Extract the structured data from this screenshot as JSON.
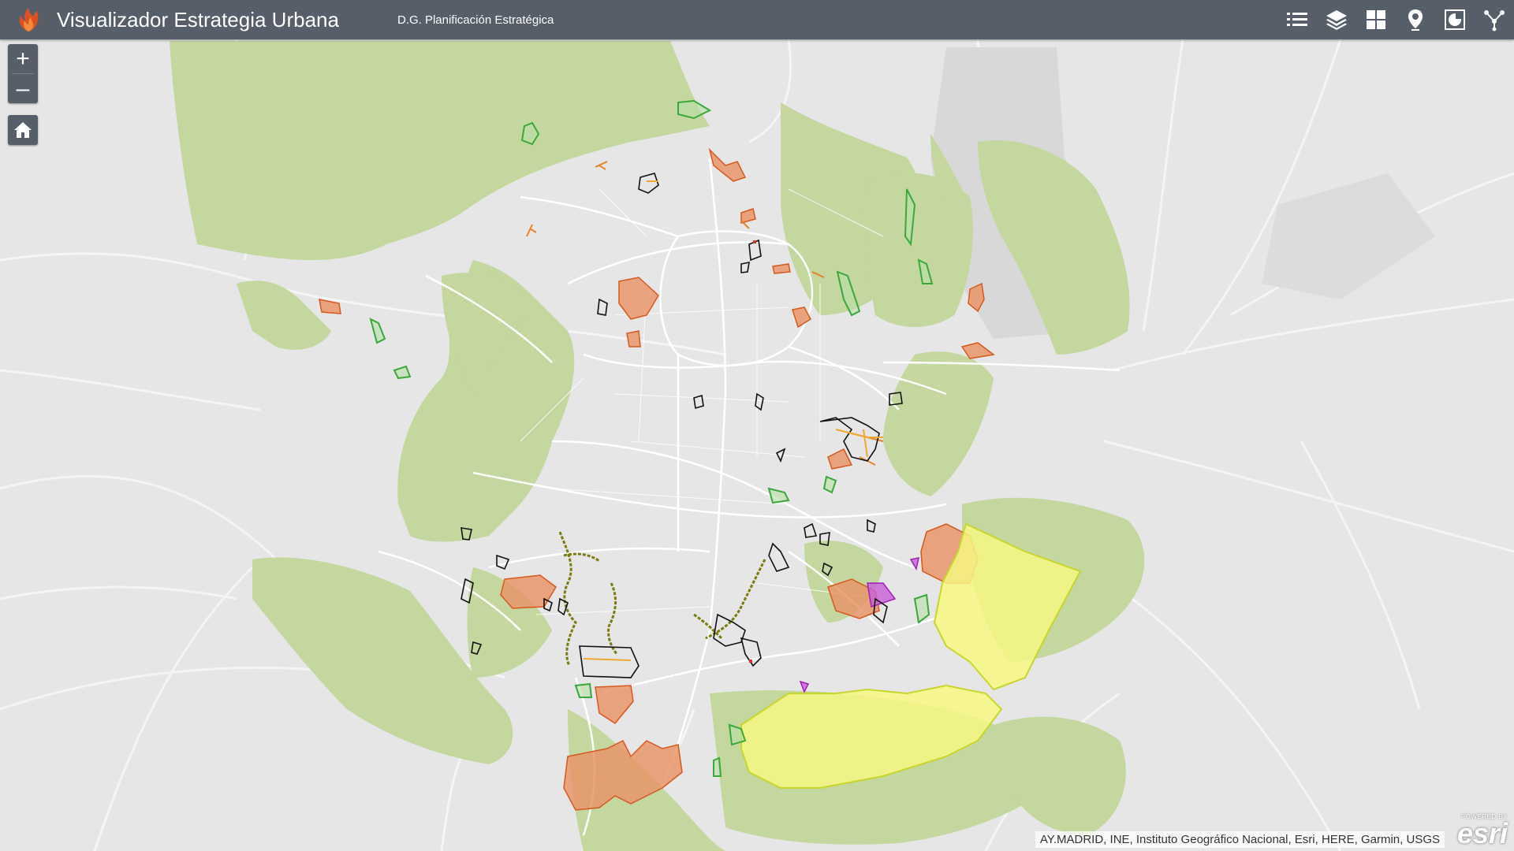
{
  "header": {
    "title": "Visualizador Estrategia Urbana",
    "subtitle": "D.G. Planificación Estratégica",
    "logo_icon": "flame-logo-icon",
    "tools": [
      {
        "name": "legend-list-icon"
      },
      {
        "name": "layers-icon"
      },
      {
        "name": "basemap-gallery-icon"
      },
      {
        "name": "location-pin-icon"
      },
      {
        "name": "chart-dashboard-icon"
      },
      {
        "name": "share-icon"
      }
    ]
  },
  "map": {
    "zoom_in_label": "+",
    "zoom_out_label": "–",
    "home_icon": "home-icon",
    "attribution": "AY.MADRID, INE, Instituto Geográfico Nacional, Esri, HERE, Garmin, USGS",
    "esri_powered": "POWERED BY",
    "esri_logo": "esri"
  },
  "colors": {
    "header": "#565e6a",
    "basemap": "#e6e6e6",
    "roads": "#ffffff",
    "parks": "#c3d79e",
    "orange_areas": "#e8956a",
    "yellow_areas": "#f5f57a",
    "green_outlines": "#3aa83a",
    "olive_lines": "#7a7a10",
    "black_outlines": "#111111"
  }
}
